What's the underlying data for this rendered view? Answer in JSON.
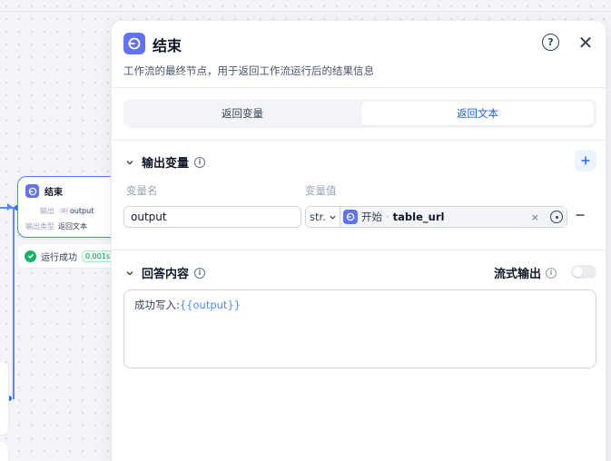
{
  "canvas": {
    "node": {
      "title": "结束",
      "rows": [
        {
          "key": "输出",
          "type": "str",
          "value": "output"
        },
        {
          "key": "输出类型",
          "value": "返回文本"
        }
      ]
    },
    "run_status": {
      "label": "运行成功",
      "time": "0.001s"
    }
  },
  "panel": {
    "title": "结束",
    "description": "工作流的最终节点，用于返回工作流运行后的结果信息",
    "tabs": [
      {
        "label": "返回变量",
        "active": false
      },
      {
        "label": "返回文本",
        "active": true
      }
    ],
    "output_section": {
      "title": "输出变量",
      "col_name_label": "变量名",
      "col_value_label": "变量值",
      "rows": [
        {
          "name": "output",
          "type": "str.",
          "node": "开始",
          "separator": "·",
          "variable": "table_url",
          "clear": "×"
        }
      ]
    },
    "answer_section": {
      "title": "回答内容",
      "stream_label": "流式输出",
      "stream_enabled": false,
      "content_prefix": "成功写入:",
      "content_variable": "{{output}}"
    }
  },
  "icons": {
    "help": "question-circle-icon",
    "close": "close-icon",
    "add": "plus-icon",
    "remove": "minus-icon",
    "info": "info-icon",
    "chevron": "chevron-down-icon",
    "node": "end-node-icon",
    "target": "crosshair-icon"
  },
  "colors": {
    "accent": "#155eef",
    "node_icon": "#6172f3",
    "success": "#17b26a"
  }
}
